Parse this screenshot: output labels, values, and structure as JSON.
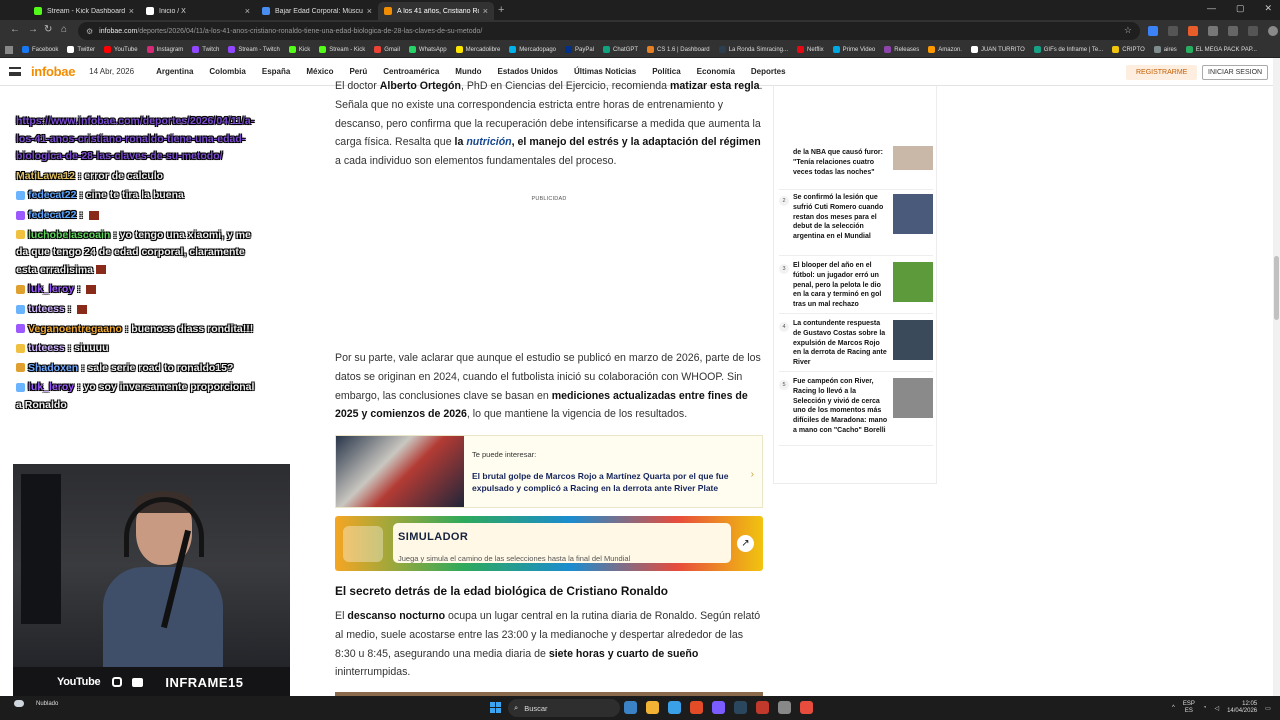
{
  "browser": {
    "tabs": [
      {
        "label": "Stream - Kick Dashboard",
        "color": "#53fc18"
      },
      {
        "label": "Inicio / X",
        "color": "#ffffff"
      },
      {
        "label": "Bajar Edad Corporal: Músculo y",
        "color": "#4a8df0"
      },
      {
        "label": "A los 41 años, Cristiano Ronaldo",
        "color": "#f28c00"
      }
    ],
    "close_glyph": "×",
    "new_tab_glyph": "+",
    "url_host": "infobae.com",
    "url_path": "/deportes/2026/04/11/a-los-41-anos-cristiano-ronaldo-tiene-una-edad-biologica-de-28-las-claves-de-su-metodo/",
    "bookmarks": [
      {
        "label": "Facebook",
        "color": "#1877f2"
      },
      {
        "label": "Twitter",
        "color": "#ffffff"
      },
      {
        "label": "YouTube",
        "color": "#ff0000"
      },
      {
        "label": "Instagram",
        "color": "#d62976"
      },
      {
        "label": "Twitch",
        "color": "#9146ff"
      },
      {
        "label": "Stream - Twitch",
        "color": "#9146ff"
      },
      {
        "label": "Kick",
        "color": "#53fc18"
      },
      {
        "label": "Stream - Kick",
        "color": "#53fc18"
      },
      {
        "label": "Gmail",
        "color": "#ea4335"
      },
      {
        "label": "WhatsApp",
        "color": "#25d366"
      },
      {
        "label": "Mercadolibre",
        "color": "#ffe600"
      },
      {
        "label": "Mercadopago",
        "color": "#00b1ea"
      },
      {
        "label": "PayPal",
        "color": "#003087"
      },
      {
        "label": "ChatGPT",
        "color": "#10a37f"
      },
      {
        "label": "CS 1.6 | Dashboard",
        "color": "#e67e22"
      },
      {
        "label": "La Ronda Simracing...",
        "color": "#2c3e50"
      },
      {
        "label": "Netflix",
        "color": "#e50914"
      },
      {
        "label": "Prime Video",
        "color": "#00a8e1"
      },
      {
        "label": "Releases",
        "color": "#8e44ad"
      },
      {
        "label": "Amazon.",
        "color": "#ff9900"
      },
      {
        "label": "JUAN TURRITO",
        "color": "#ffffff"
      },
      {
        "label": "GIFs de Inframe | Te...",
        "color": "#16a085"
      },
      {
        "label": "CRIPTO",
        "color": "#f1c40f"
      },
      {
        "label": "aires",
        "color": "#7f8c8d"
      },
      {
        "label": "EL MEGA PACK PAP...",
        "color": "#27ae60"
      }
    ]
  },
  "site": {
    "logo": "infobae",
    "date": "14 Abr, 2026",
    "nav": [
      "Argentina",
      "Colombia",
      "España",
      "México",
      "Perú",
      "Centroamérica",
      "Mundo",
      "Estados Unidos",
      "Últimas Noticias",
      "Política",
      "Economía",
      "Deportes"
    ],
    "register": "REGISTRARME",
    "login": "INICIAR SESION"
  },
  "chat": {
    "link": "https://www.infobae.com/deportes/2026/04/11/a-los-41-anos-cristiano-ronaldo-tiene-una-edad-biologica-de-28-las-claves-de-su-metodo/",
    "messages": [
      {
        "user": "MatiLawa12",
        "color": "#e0c060",
        "text": " : error de calculo"
      },
      {
        "user": "fedecat22",
        "color": "#5ba4ff",
        "text": " : cine te tira la buena"
      },
      {
        "user": "fedecat22",
        "color": "#5ba4ff",
        "text": " : "
      },
      {
        "user": "luchobelascoain",
        "color": "#5cd65c",
        "text": " : yo tengo una xiaomi, y me da que tengo 24 de edad corporal, claramente esta erradisima"
      },
      {
        "user": "luk_leroy",
        "color": "#9b59ff",
        "text": " : "
      },
      {
        "user": "tuteess",
        "color": "#d0b4ff",
        "text": " : "
      },
      {
        "user": "Veganoentregaano",
        "color": "#f0a830",
        "text": " : buenoss diass rondita!!!"
      },
      {
        "user": "tuteess",
        "color": "#d0b4ff",
        "text": " : siuuuu"
      },
      {
        "user": "Shadoxen",
        "color": "#6fa8ff",
        "text": " : sale serie road to ronaldo15?"
      },
      {
        "user": "luk_leroy",
        "color": "#9b59ff",
        "text": " : yo soy inversamente proporcional a Ronaldo"
      }
    ]
  },
  "cam": {
    "platform": "YouTube",
    "channel": "INFRAME15"
  },
  "article": {
    "p1": [
      {
        "t": "El doctor "
      },
      {
        "t": "Alberto Ortegón",
        "b": true
      },
      {
        "t": ", PhD en Ciencias del Ejercicio, recomienda "
      },
      {
        "t": "matizar esta regla",
        "b": true
      },
      {
        "t": ". Señala que no existe una correspondencia estricta entre horas de entrenamiento y descanso, pero confirma que la recuperación debe intensificarse a medida que aumenta la carga física. Resalta que "
      },
      {
        "t": "la ",
        "b": true
      },
      {
        "t": "nutrición",
        "link": true
      },
      {
        "t": ", el manejo del estrés y la adaptación del régimen",
        "b": true
      },
      {
        "t": " a cada individuo son elementos fundamentales del proceso."
      }
    ],
    "ad_label": "PUBLICIDAD",
    "p2": [
      {
        "t": "Por su parte, vale aclarar que aunque el estudio se publicó en marzo de 2026, parte de los datos se originan en 2024, cuando el futbolista inició su colaboración con WHOOP. Sin embargo, las conclusiones clave se basan en "
      },
      {
        "t": "mediciones actualizadas entre fines de 2025 y comienzos de 2026",
        "b": true
      },
      {
        "t": ", lo que mantiene la vigencia de los resultados."
      }
    ],
    "related_kicker": "Te puede interesar:",
    "related_title": "El brutal golpe de Marcos Rojo a Martínez Quarta por el que fue expulsado y complicó a Racing en la derrota ante River Plate",
    "related_chevron": "›",
    "sim_title": "SIMULADOR",
    "sim_desc": "Juega y simula el camino de las selecciones hasta la final del Mundial",
    "sim_go": "↗",
    "h2": "El secreto detrás de la edad biológica de Cristiano Ronaldo",
    "p3": [
      {
        "t": "El "
      },
      {
        "t": "descanso nocturno",
        "b": true
      },
      {
        "t": " ocupa un lugar central en la rutina diaria de Ronaldo. Según relató al medio, suele acostarse entre las 23:00 y la medianoche y despertar alrededor de las 8:30 u 8:45, asegurando una media diaria de "
      },
      {
        "t": "siete horas y cuarto de sueño",
        "b": true
      },
      {
        "t": " ininterrumpidas."
      }
    ]
  },
  "sidebar": [
    {
      "num": "",
      "text": "de la NBA que causó furor: \"Tenía relaciones cuatro veces todas las noches\"",
      "thumb": "#c9b8a8"
    },
    {
      "num": "2",
      "text": "Se confirmó la lesión que sufrió Cuti Romero cuando restan dos meses para el debut de la selección argentina en el Mundial",
      "thumb": "#4a5a7a"
    },
    {
      "num": "3",
      "text": "El blooper del año en el fútbol: un jugador erró un penal, pero la pelota le dio en la cara y terminó en gol tras un mal rechazo",
      "thumb": "#5c9a3c"
    },
    {
      "num": "4",
      "text": "La contundente respuesta de Gustavo Costas sobre la expulsión de Marcos Rojo en la derrota de Racing ante River",
      "thumb": "#3a4a5a"
    },
    {
      "num": "5",
      "text": "Fue campeón con River, Racing lo llevó a la Selección y vivió de cerca uno de los momentos más difíciles de Maradona: mano a mano con \"Cacho\" Borelli",
      "thumb": "#8a8a8a"
    }
  ],
  "taskbar": {
    "weather": "Nublado",
    "search": "Buscar",
    "lang_top": "ESP",
    "lang_bottom": "ES",
    "time": "12:05",
    "date": "14/04/2026",
    "apps": [
      "#3b82c4",
      "#f2b233",
      "#3aa0e8",
      "#e34c26",
      "#7a5cff",
      "#2a475e",
      "#c0392b",
      "#888888",
      "#e74c3c"
    ]
  }
}
